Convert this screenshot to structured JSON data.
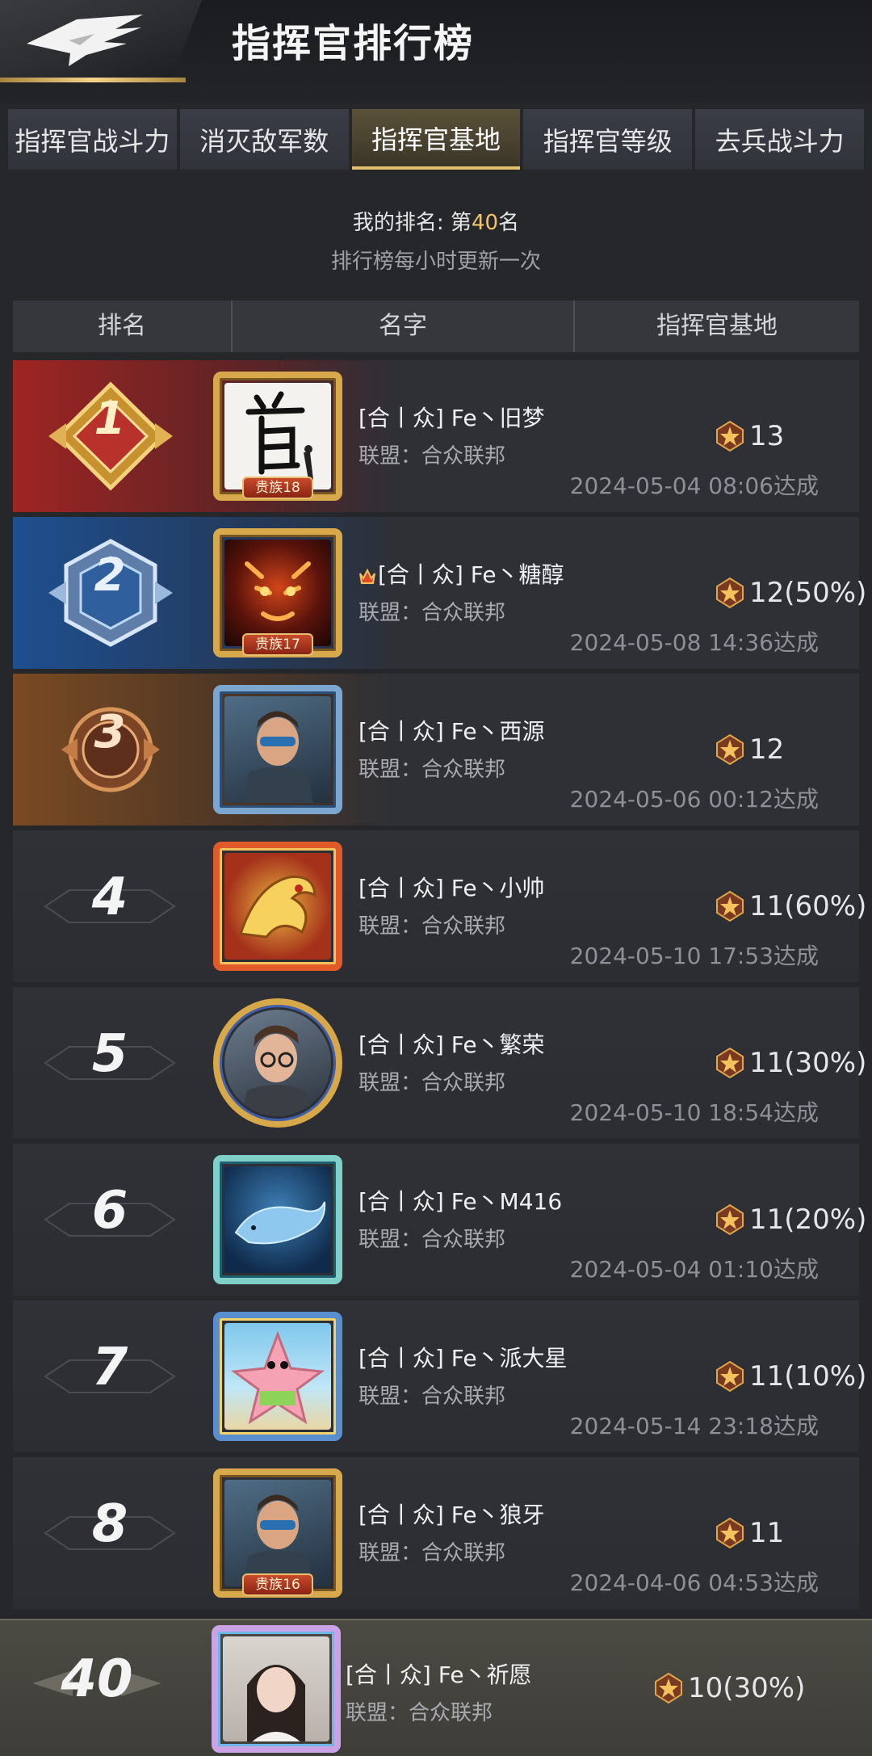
{
  "header": {
    "title": "指挥官排行榜"
  },
  "tabs": [
    {
      "label": "指挥官战斗力"
    },
    {
      "label": "消灭敌军数"
    },
    {
      "label": "指挥官基地",
      "active": true
    },
    {
      "label": "指挥官等级"
    },
    {
      "label": "去兵战斗力"
    }
  ],
  "my_rank": {
    "prefix": "我的排名: 第",
    "value": "40",
    "suffix": "名",
    "note": "排行榜每小时更新一次"
  },
  "table": {
    "columns": [
      "排名",
      "名字",
      "指挥官基地"
    ],
    "rows": [
      {
        "rank": "1",
        "name": "[合丨众] Fe丶旧梦",
        "alliance": "联盟：合众联邦",
        "score": "13",
        "time": "2024-05-04 08:06达成",
        "tag": "贵族18"
      },
      {
        "rank": "2",
        "name": "[合丨众] Fe丶糖醇",
        "alliance": "联盟：合众联邦",
        "score": "12(50%)",
        "time": "2024-05-08 14:36达成",
        "tag": "贵族17"
      },
      {
        "rank": "3",
        "name": "[合丨众] Fe丶西源",
        "alliance": "联盟：合众联邦",
        "score": "12",
        "time": "2024-05-06 00:12达成",
        "tag": ""
      },
      {
        "rank": "4",
        "name": "[合丨众] Fe丶小帅",
        "alliance": "联盟：合众联邦",
        "score": "11(60%)",
        "time": "2024-05-10 17:53达成",
        "tag": ""
      },
      {
        "rank": "5",
        "name": "[合丨众] Fe丶繁荣",
        "alliance": "联盟：合众联邦",
        "score": "11(30%)",
        "time": "2024-05-10 18:54达成",
        "tag": ""
      },
      {
        "rank": "6",
        "name": "[合丨众] Fe丶M416",
        "alliance": "联盟：合众联邦",
        "score": "11(20%)",
        "time": "2024-05-04 01:10达成",
        "tag": ""
      },
      {
        "rank": "7",
        "name": "[合丨众] Fe丶派大星",
        "alliance": "联盟：合众联邦",
        "score": "11(10%)",
        "time": "2024-05-14 23:18达成",
        "tag": ""
      },
      {
        "rank": "8",
        "name": "[合丨众] Fe丶狼牙",
        "alliance": "联盟：合众联邦",
        "score": "11",
        "time": "2024-04-06 04:53达成",
        "tag": "贵族16"
      }
    ],
    "mine": {
      "rank": "40",
      "name": "[合丨众] Fe丶祈愿",
      "alliance": "联盟：合众联邦",
      "score": "10(30%)"
    }
  },
  "colors": {
    "accent_gold": "#e2bf6c",
    "rank1": "#b42a25",
    "rank2": "#2d6bc0",
    "rank3": "#a5642e"
  },
  "icons": [
    "back-eagle-icon",
    "rank-gold-badge-icon",
    "rank-silver-badge-icon",
    "rank-bronze-badge-icon",
    "base-medal-icon",
    "crown-icon"
  ]
}
